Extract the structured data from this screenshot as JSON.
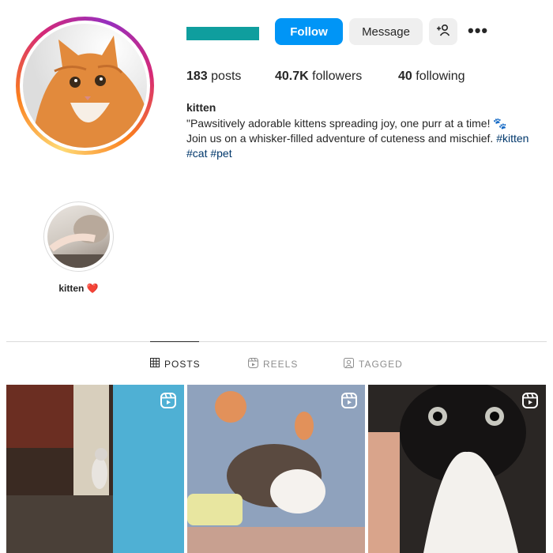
{
  "profile": {
    "follow_label": "Follow",
    "message_label": "Message",
    "more_label": "•••"
  },
  "stats": {
    "posts_count": "183",
    "posts_label": "posts",
    "followers_count": "40.7K",
    "followers_label": "followers",
    "following_count": "40",
    "following_label": "following"
  },
  "bio": {
    "name": "kitten",
    "line1": "\"Pawsitively adorable kittens spreading joy, one purr at a time! 🐾",
    "line2": "Join us on a whisker-filled adventure of cuteness and mischief.",
    "tags": [
      "#kitten",
      "#cat",
      "#pet"
    ]
  },
  "highlight": {
    "label": "kitten",
    "emoji": "❤️"
  },
  "tabs": [
    {
      "label": "POSTS",
      "icon": "grid-icon"
    },
    {
      "label": "REELS",
      "icon": "reels-icon"
    },
    {
      "label": "TAGGED",
      "icon": "tagged-icon"
    }
  ],
  "colors": {
    "follow_button": "#0095f6",
    "username_redaction": "#0f9e9e",
    "hashtag": "#00376b"
  }
}
